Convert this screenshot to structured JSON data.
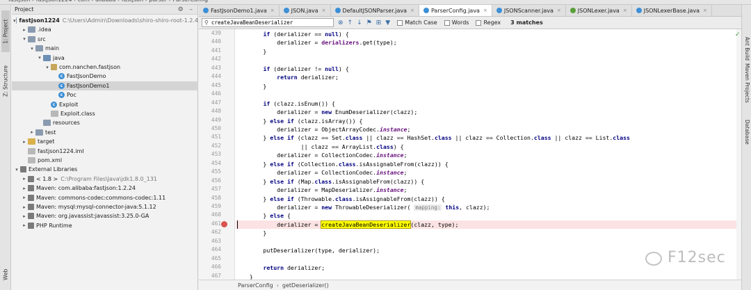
{
  "window": {
    "breadcrumb": [
      "fastjson",
      "fastjson1224",
      "com",
      "alibaba",
      "fastjson",
      "parser",
      "ParserConfig"
    ]
  },
  "left_tabs": [
    "1: Project",
    "Z: Structure",
    "Web"
  ],
  "right_tabs": [
    "Ant Build",
    "Maven Projects",
    "Database"
  ],
  "project": {
    "title": "Project",
    "tree": [
      {
        "label": "fastjson1224",
        "extra": "C:\\Users\\Admin\\Downloads\\shiro-shiro-root-1.2.4",
        "icon": "folder-icon"
      },
      {
        "label": ".idea",
        "extra": "",
        "icon": "folder-icon"
      },
      {
        "label": "src",
        "extra": "",
        "icon": "folder-icon"
      },
      {
        "label": "main",
        "extra": "",
        "icon": "folder-icon"
      },
      {
        "label": "java",
        "extra": "",
        "icon": "source-folder-icon"
      },
      {
        "label": "com.nanchen.fastjson",
        "extra": "",
        "icon": "package-icon"
      },
      {
        "label": "FastJsonDemo",
        "extra": "",
        "icon": "class-icon"
      },
      {
        "label": "FastJsonDemo1",
        "extra": "",
        "icon": "class-icon"
      },
      {
        "label": "Poc",
        "extra": "",
        "icon": "class-icon"
      },
      {
        "label": "Exploit",
        "extra": "",
        "icon": "class-icon"
      },
      {
        "label": "Exploit.class",
        "extra": "",
        "icon": "file-icon"
      },
      {
        "label": "resources",
        "extra": "",
        "icon": "folder-icon"
      },
      {
        "label": "test",
        "extra": "",
        "icon": "folder-icon"
      },
      {
        "label": "target",
        "extra": "",
        "icon": "folder-icon"
      },
      {
        "label": "fastjson1224.iml",
        "extra": "",
        "icon": "file-icon"
      },
      {
        "label": "pom.xml",
        "extra": "",
        "icon": "maven-icon"
      },
      {
        "label": "External Libraries",
        "extra": "",
        "icon": "library-icon"
      },
      {
        "label": "< 1.8 >",
        "extra": "C:\\Program Files\\Java\\jdk1.8.0_131",
        "icon": "library-icon"
      },
      {
        "label": "Maven: com.alibaba:fastjson:1.2.24",
        "extra": "",
        "icon": "library-icon"
      },
      {
        "label": "Maven: commons-codec:commons-codec:1.11",
        "extra": "",
        "icon": "library-icon"
      },
      {
        "label": "Maven: mysql:mysql-connector-java:5.1.12",
        "extra": "",
        "icon": "library-icon"
      },
      {
        "label": "Maven: org.javassist:javassist:3.25.0-GA",
        "extra": "",
        "icon": "library-icon"
      },
      {
        "label": "PHP Runtime",
        "extra": "",
        "icon": "library-icon"
      }
    ],
    "selected": "FastJsonDemo1"
  },
  "tabs": [
    "FastJsonDemo1.java",
    "JSON.java",
    "DefaultJSONParser.java",
    "ParserConfig.java",
    "JSONScanner.java",
    "JSONLexer.java",
    "JSONLexerBase.java"
  ],
  "active_tab": "ParserConfig.java",
  "search": {
    "query": "createJavaBeanDeserializer",
    "match_case": "Match Case",
    "words": "Words",
    "regex": "Regex",
    "matches": "3 matches"
  },
  "code": {
    "lines": [
      {
        "n": "439",
        "t": "        if (derializer == null) {"
      },
      {
        "n": "440",
        "t": "            derializer = derializers.get(type);"
      },
      {
        "n": "441",
        "t": "        }"
      },
      {
        "n": "442",
        "t": ""
      },
      {
        "n": "443",
        "t": "        if (derializer != null) {"
      },
      {
        "n": "444",
        "t": "            return derializer;"
      },
      {
        "n": "445",
        "t": "        }"
      },
      {
        "n": "446",
        "t": ""
      },
      {
        "n": "447",
        "t": "        if (clazz.isEnum()) {"
      },
      {
        "n": "448",
        "t": "            derializer = new EnumDeserializer(clazz);"
      },
      {
        "n": "449",
        "t": "        } else if (clazz.isArray()) {"
      },
      {
        "n": "450",
        "t": "            derializer = ObjectArrayCodec.instance;"
      },
      {
        "n": "451",
        "t": "        } else if (clazz == Set.class || clazz == HashSet.class || clazz == Collection.class || clazz == List.class"
      },
      {
        "n": "452",
        "t": "                   || clazz == ArrayList.class) {"
      },
      {
        "n": "453",
        "t": "            derializer = CollectionCodec.instance;"
      },
      {
        "n": "454",
        "t": "        } else if (Collection.class.isAssignableFrom(clazz)) {"
      },
      {
        "n": "455",
        "t": "            derializer = CollectionCodec.instance;"
      },
      {
        "n": "456",
        "t": "        } else if (Map.class.isAssignableFrom(clazz)) {"
      },
      {
        "n": "457",
        "t": "            derializer = MapDeserializer.instance;"
      },
      {
        "n": "458",
        "t": "        } else if (Throwable.class.isAssignableFrom(clazz)) {"
      },
      {
        "n": "459",
        "t": "            derializer = new ThrowableDeserializer( mapping: this, clazz);"
      },
      {
        "n": "460",
        "t": "        } else {"
      },
      {
        "n": "461",
        "t": "            derializer = createJavaBeanDeserializer(clazz, type);"
      },
      {
        "n": "462",
        "t": "        }"
      },
      {
        "n": "463",
        "t": ""
      },
      {
        "n": "464",
        "t": "        putDeserializer(type, derializer);"
      },
      {
        "n": "465",
        "t": ""
      },
      {
        "n": "466",
        "t": "        return derializer;"
      },
      {
        "n": "467",
        "t": "    }"
      }
    ],
    "breakpoint_line": "461"
  },
  "status": {
    "class": "ParserConfig",
    "method": "getDeserializer()"
  },
  "watermark": "F12sec",
  "colors": {
    "keyword": "#000080",
    "field": "#660e7a",
    "match_highlight": "#ffff00",
    "breakpoint": "#d9534f",
    "current_line": "#fbe3e3"
  }
}
